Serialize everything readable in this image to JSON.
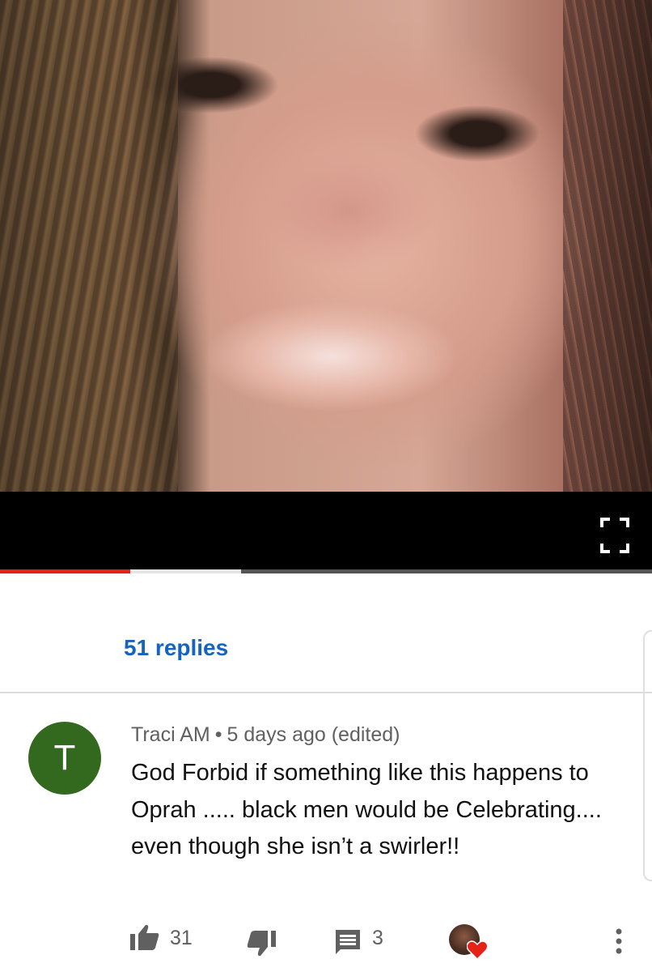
{
  "video": {
    "description_icon": "fullscreen-icon",
    "progress": {
      "played_fraction": 0.2,
      "buffered_fraction": 0.37,
      "played_color": "#e62117"
    }
  },
  "replies_link": "51 replies",
  "comment": {
    "avatar_letter": "T",
    "avatar_color": "#33691e",
    "author": "Traci AM",
    "separator": "•",
    "time": "5 days ago (edited)",
    "text": "God Forbid if something like this happens to Oprah ..... black men would be Celebrating.... even though she isn’t a swirler!!",
    "actions": {
      "like_icon": "thumbs-up-icon",
      "like_count": "31",
      "dislike_icon": "thumbs-down-icon",
      "reply_icon": "reply-comment-icon",
      "reply_count": "3",
      "creator_heart_icon": "creator-heart-icon",
      "menu_icon": "more-vertical-icon"
    }
  }
}
